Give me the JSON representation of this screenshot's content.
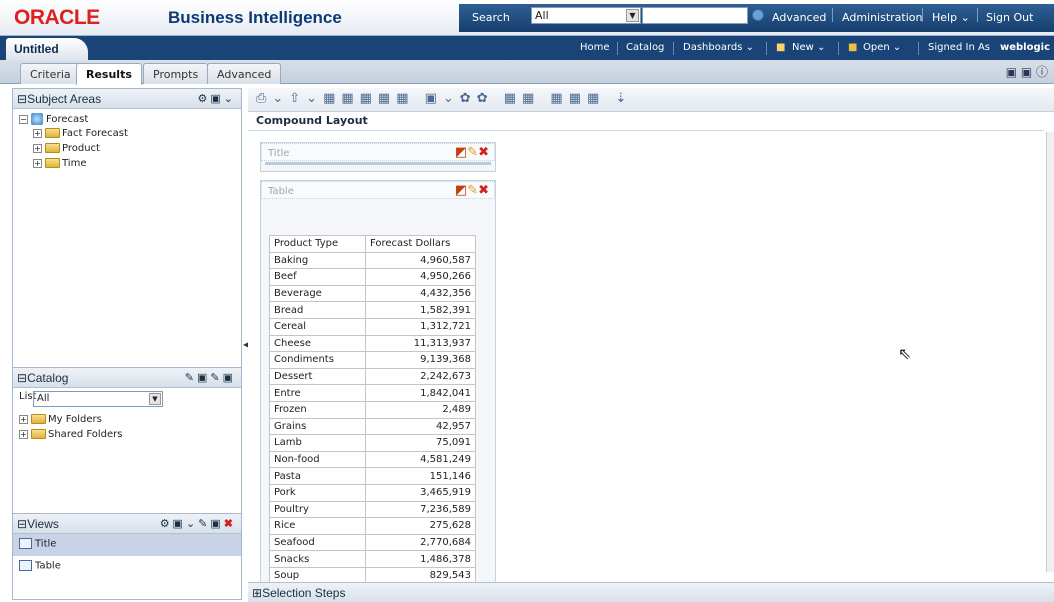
{
  "header": {
    "logo": "ORACLE",
    "product": "Business Intelligence",
    "search_label": "Search",
    "search_scope": "All",
    "advanced": "Advanced",
    "administration": "Administration",
    "help": "Help ⌄",
    "sign_out": "Sign Out"
  },
  "nav": {
    "doc_title": "Untitled",
    "home": "Home",
    "catalog": "Catalog",
    "dashboards": "Dashboards ⌄",
    "new": "New ⌄",
    "open": "Open ⌄",
    "signed_in_label": "Signed In As",
    "user": "weblogic"
  },
  "tabs": [
    "Criteria",
    "Results",
    "Prompts",
    "Advanced"
  ],
  "subject_areas": {
    "title": "Subject Areas",
    "root": "Forecast",
    "children": [
      "Fact Forecast",
      "Product",
      "Time"
    ]
  },
  "catalog": {
    "title": "Catalog",
    "list_label": "List",
    "list_value": "All",
    "items": [
      "My Folders",
      "Shared Folders"
    ]
  },
  "views": {
    "title": "Views",
    "items": [
      "Title",
      "Table"
    ]
  },
  "main": {
    "layout_title": "Compound Layout",
    "title_view_label": "Title",
    "table_view_label": "Table",
    "selection_steps": "Selection Steps"
  },
  "table": {
    "headers": [
      "Product Type",
      "Forecast Dollars"
    ],
    "rows": [
      [
        "Baking",
        "4,960,587"
      ],
      [
        "Beef",
        "4,950,266"
      ],
      [
        "Beverage",
        "4,432,356"
      ],
      [
        "Bread",
        "1,582,391"
      ],
      [
        "Cereal",
        "1,312,721"
      ],
      [
        "Cheese",
        "11,313,937"
      ],
      [
        "Condiments",
        "9,139,368"
      ],
      [
        "Dessert",
        "2,242,673"
      ],
      [
        "Entre",
        "1,842,041"
      ],
      [
        "Frozen",
        "2,489"
      ],
      [
        "Grains",
        "42,957"
      ],
      [
        "Lamb",
        "75,091"
      ],
      [
        "Non-food",
        "4,581,249"
      ],
      [
        "Pasta",
        "151,146"
      ],
      [
        "Pork",
        "3,465,919"
      ],
      [
        "Poultry",
        "7,236,589"
      ],
      [
        "Rice",
        "275,628"
      ],
      [
        "Seafood",
        "2,770,684"
      ],
      [
        "Snacks",
        "1,486,378"
      ],
      [
        "Soup",
        "829,543"
      ]
    ]
  }
}
